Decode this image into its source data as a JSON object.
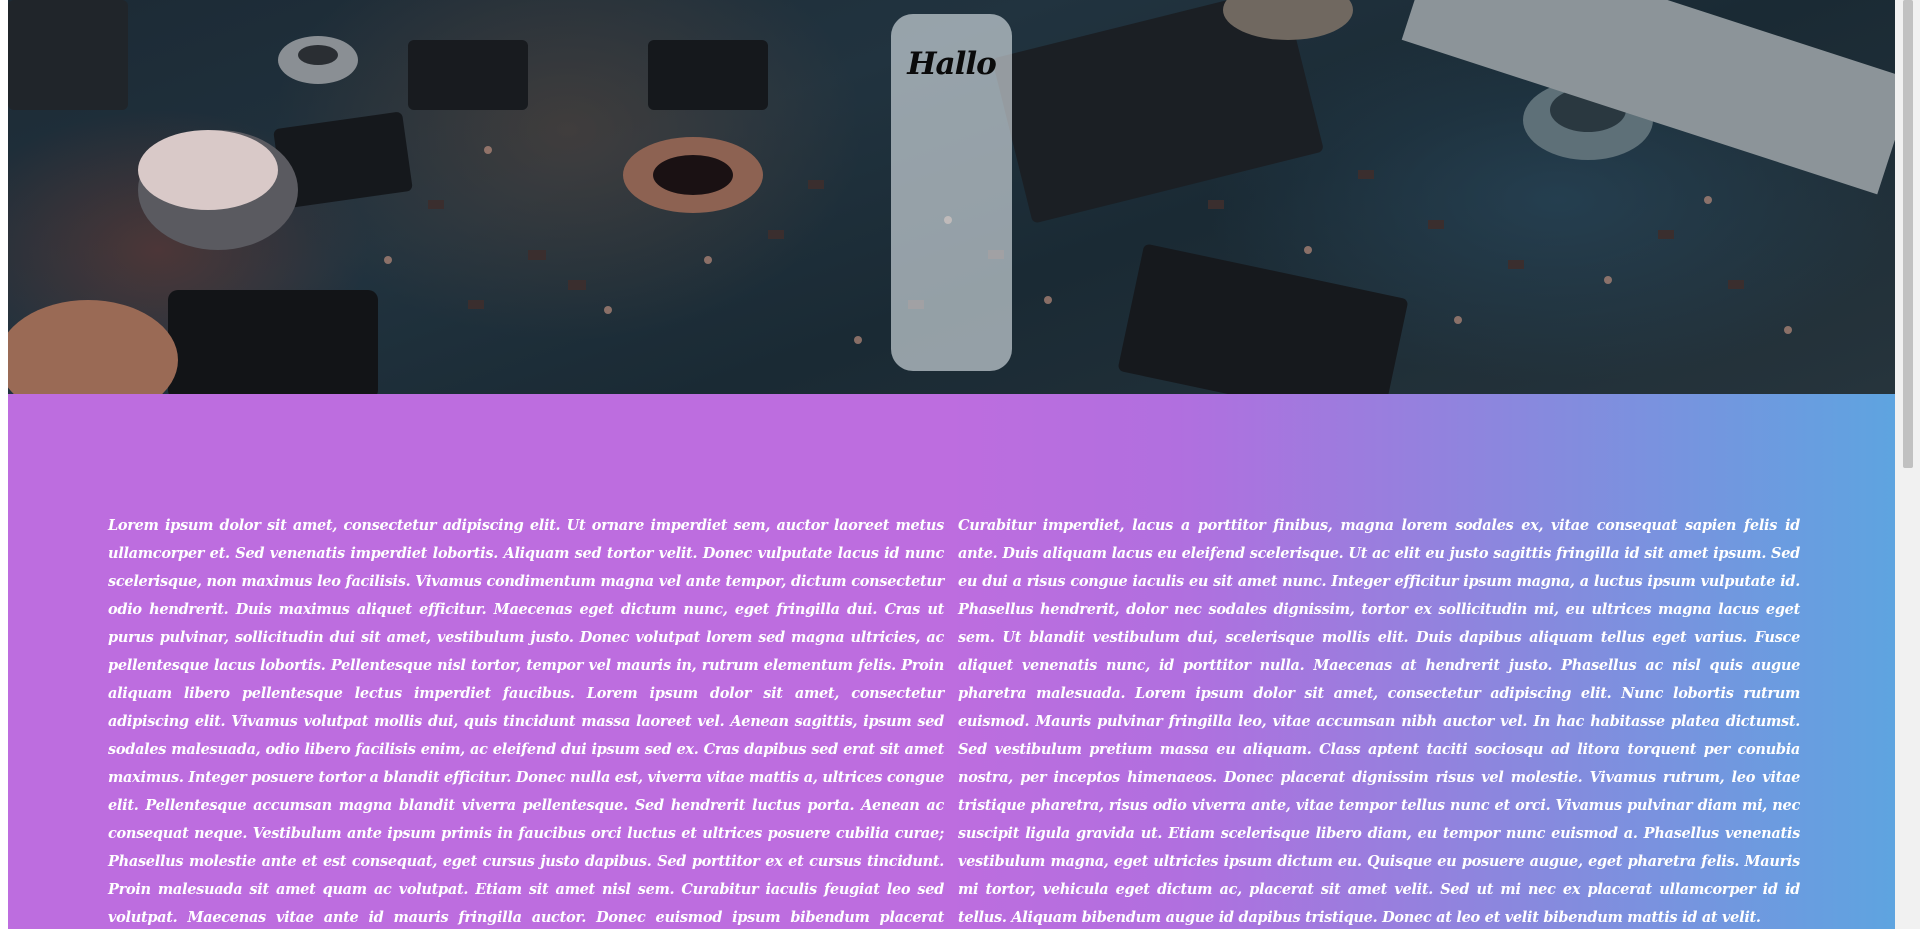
{
  "hero": {
    "image_alt_icon": "circuit-board-image",
    "card": {
      "title": "Hallo"
    }
  },
  "content": {
    "gradient_colors": [
      "#bd6ddf",
      "#5ea4e0"
    ],
    "left_paragraph": "Lorem ipsum dolor sit amet, consectetur adipiscing elit. Ut ornare imperdiet sem, auctor laoreet metus ullamcorper et. Sed venenatis imperdiet lobortis. Aliquam sed tortor velit. Donec vulputate lacus id nunc scelerisque, non maximus leo facilisis. Vivamus condimentum magna vel ante tempor, dictum consectetur odio hendrerit. Duis maximus aliquet efficitur. Maecenas eget dictum nunc, eget fringilla dui. Cras ut purus pulvinar, sollicitudin dui sit amet, vestibulum justo. Donec volutpat lorem sed magna ultricies, ac pellentesque lacus lobortis. Pellentesque nisl tortor, tempor vel mauris in, rutrum elementum felis. Proin aliquam libero pellentesque lectus imperdiet faucibus. Lorem ipsum dolor sit amet, consectetur adipiscing elit. Vivamus volutpat mollis dui, quis tincidunt massa laoreet vel. Aenean sagittis, ipsum sed sodales malesuada, odio libero facilisis enim, ac eleifend dui ipsum sed ex. Cras dapibus sed erat sit amet maximus. Integer posuere tortor a blandit efficitur. Donec nulla est, viverra vitae mattis a, ultrices congue elit. Pellentesque accumsan magna blandit viverra pellentesque. Sed hendrerit luctus porta. Aenean ac consequat neque. Vestibulum ante ipsum primis in faucibus orci luctus et ultrices posuere cubilia curae; Phasellus molestie ante et est consequat, eget cursus justo dapibus. Sed porttitor ex et cursus tincidunt. Proin malesuada sit amet quam ac volutpat. Etiam sit amet nisl sem. Curabitur iaculis feugiat leo sed volutpat. Maecenas vitae ante id mauris fringilla auctor. Donec euismod ipsum bibendum placerat gravida. Sed feugiat sapien ac nulla feugiat placerat sed nec enim.",
    "right_paragraph": "Curabitur imperdiet, lacus a porttitor finibus, magna lorem sodales ex, vitae consequat sapien felis id ante. Duis aliquam lacus eu eleifend scelerisque. Ut ac elit eu justo sagittis fringilla id sit amet ipsum. Sed eu dui a risus congue iaculis eu sit amet nunc. Integer efficitur ipsum magna, a luctus ipsum vulputate id. Phasellus hendrerit, dolor nec sodales dignissim, tortor ex sollicitudin mi, eu ultrices magna lacus eget sem. Ut blandit vestibulum dui, scelerisque mollis elit. Duis dapibus aliquam tellus eget varius. Fusce aliquet venenatis nunc, id porttitor nulla. Maecenas at hendrerit justo. Phasellus ac nisl quis augue pharetra malesuada. Lorem ipsum dolor sit amet, consectetur adipiscing elit. Nunc lobortis rutrum euismod. Mauris pulvinar fringilla leo, vitae accumsan nibh auctor vel. In hac habitasse platea dictumst. Sed vestibulum pretium massa eu aliquam. Class aptent taciti sociosqu ad litora torquent per conubia nostra, per inceptos himenaeos. Donec placerat dignissim risus vel molestie. Vivamus rutrum, leo vitae tristique pharetra, risus odio viverra ante, vitae tempor tellus nunc et orci. Vivamus pulvinar diam mi, nec suscipit ligula gravida ut. Etiam scelerisque libero diam, eu tempor nunc euismod a. Phasellus venenatis vestibulum magna, eget ultricies ipsum dictum eu. Quisque eu posuere augue, eget pharetra felis. Mauris mi tortor, vehicula eget dictum ac, placerat sit amet velit. Sed ut mi nec ex placerat ullamcorper id id tellus. Aliquam bibendum augue id dapibus tristique. Donec at leo et velit bibendum mattis id at velit."
  }
}
